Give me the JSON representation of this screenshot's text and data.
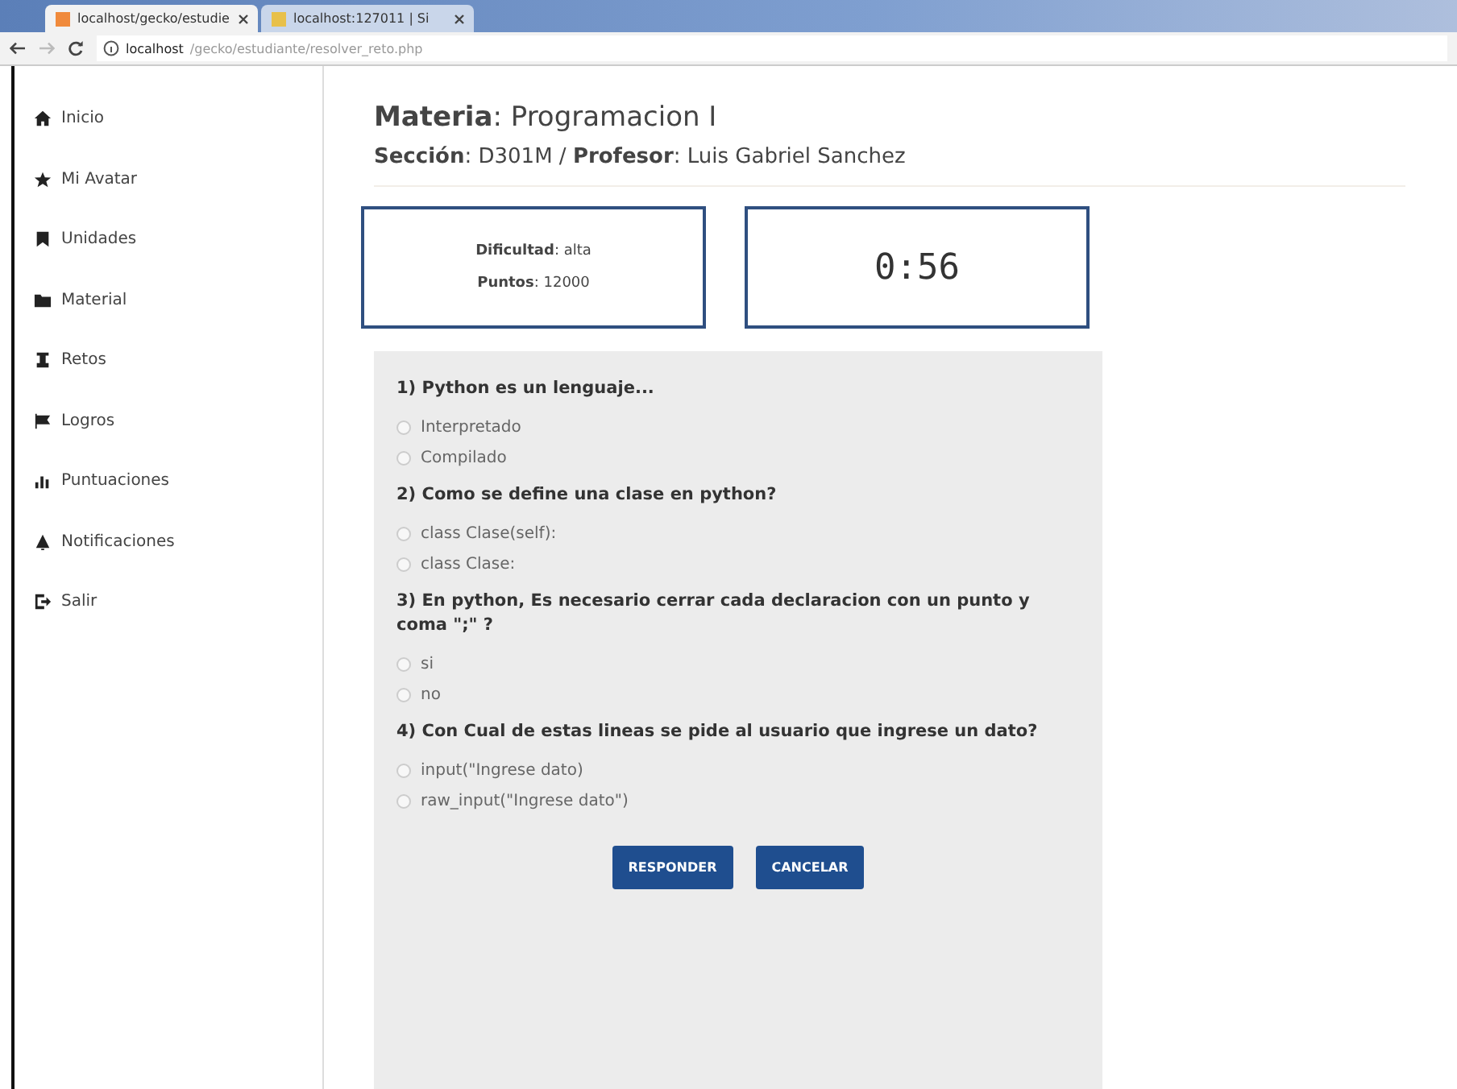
{
  "browser": {
    "tabs": [
      {
        "title": "localhost/gecko/estudie",
        "selected": true
      },
      {
        "title": "localhost:127011 | Si",
        "selected": false
      }
    ],
    "address": {
      "host": "localhost",
      "path": "/gecko/estudiante/resolver_reto.php"
    }
  },
  "sidebar": {
    "items": [
      {
        "label": "Inicio"
      },
      {
        "label": "Mi Avatar"
      },
      {
        "label": "Unidades"
      },
      {
        "label": "Material"
      },
      {
        "label": "Retos"
      },
      {
        "label": "Logros"
      },
      {
        "label": "Puntuaciones"
      },
      {
        "label": "Notificaciones"
      },
      {
        "label": "Salir"
      }
    ]
  },
  "header": {
    "title": "**Materia**: Programacion I",
    "subtitle": "**Sección**: D301M / **Profesor**: Luis Gabriel Sanchez"
  },
  "info": {
    "lines": [
      "**Dificultad**: alta",
      "**Puntos**: 12000"
    ]
  },
  "timer": "0:56",
  "questions": [
    {
      "text": "1) Python es un lenguaje...",
      "options": [
        {
          "label": "Interpretado",
          "selected": false
        },
        {
          "label": "Compilado",
          "selected": false
        }
      ]
    },
    {
      "text": "2) Como se define una clase en python?",
      "options": [
        {
          "label": "class Clase(self):",
          "selected": false
        },
        {
          "label": "class Clase:",
          "selected": false
        }
      ]
    },
    {
      "text": "3) En python, Es necesario cerrar cada declaracion con un punto y coma \";\" ?",
      "options": [
        {
          "label": "si",
          "selected": false
        },
        {
          "label": "no",
          "selected": false
        }
      ]
    },
    {
      "text": "4) Con Cual de estas lineas se pide al usuario que ingrese un dato?",
      "options": [
        {
          "label": "input(\"Ingrese dato)",
          "selected": false
        },
        {
          "label": "raw_input(\"Ingrese dato\")",
          "selected": false
        }
      ]
    }
  ],
  "buttons": [
    "RESPONDER",
    "CANCELAR"
  ]
}
